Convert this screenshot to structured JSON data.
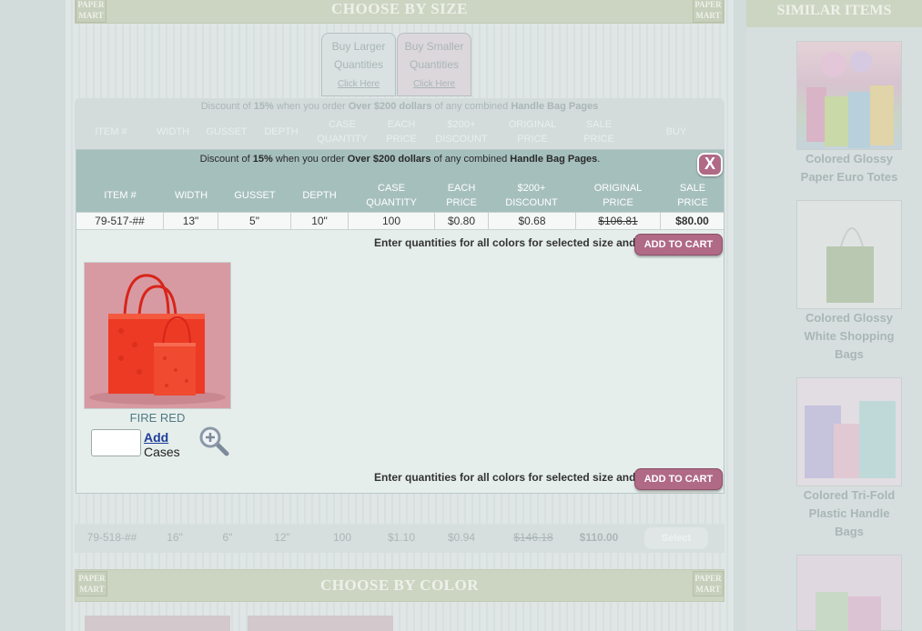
{
  "background": {
    "choose_by_size": "CHOOSE BY SIZE",
    "logo_text": "PAPER MART",
    "tab_larger": {
      "line1": "Buy Larger",
      "line2": "Quantities",
      "link": "Click Here"
    },
    "tab_smaller": {
      "line1": "Buy Smaller",
      "line2": "Quantities",
      "link": "Click Here"
    },
    "discount": {
      "pre": "Discount of ",
      "pct": "15%",
      "mid": " when you order ",
      "amount": "Over $200 dollars",
      "post": " of any combined ",
      "page": "Handle Bag Pages"
    },
    "headers": [
      "ITEM #",
      "WIDTH",
      "GUSSET",
      "DEPTH",
      "CASE QUANTITY",
      "EACH PRICE",
      "$200+ DISCOUNT",
      "ORIGINAL PRICE",
      "SALE PRICE",
      "BUY"
    ],
    "row2": {
      "item": "79-518-##",
      "width": "16\"",
      "gusset": "6\"",
      "depth": "12\"",
      "case_qty": "100",
      "each": "$1.10",
      "discount": "$0.94",
      "original": "$146.18",
      "sale": "$110.00",
      "select_label": "Select"
    },
    "choose_by_color": "CHOOSE BY COLOR"
  },
  "similar": {
    "title": "SIMILAR ITEMS",
    "items": [
      {
        "label1": "Colored Glossy",
        "label2": "Paper Euro Totes",
        "label3": ""
      },
      {
        "label1": "Colored Glossy",
        "label2": "White Shopping",
        "label3": "Bags"
      },
      {
        "label1": "Colored Tri-Fold",
        "label2": "Plastic Handle",
        "label3": "Bags"
      }
    ]
  },
  "modal": {
    "discount": {
      "pre": "Discount of ",
      "pct": "15%",
      "mid": " when you order ",
      "amount": "Over $200 dollars",
      "post": " of any combined ",
      "page": "Handle Bag Pages",
      "end": "."
    },
    "close_label": "X",
    "headers": {
      "item": "ITEM #",
      "width": "WIDTH",
      "gusset": "GUSSET",
      "depth": "DEPTH",
      "case1": "CASE",
      "case2": "QUANTITY",
      "each1": "EACH",
      "each2": "PRICE",
      "disc1": "$200+",
      "disc2": "DISCOUNT",
      "orig1": "ORIGINAL",
      "orig2": "PRICE",
      "sale1": "SALE",
      "sale2": "PRICE"
    },
    "row": {
      "item": "79-517-##",
      "width": "13\"",
      "gusset": "5\"",
      "depth": "10\"",
      "case_qty": "100",
      "each": "$0.80",
      "discount": "$0.68",
      "original": "$106.81",
      "sale": "$80.00"
    },
    "instruction": "Enter quantities for all colors for selected size and",
    "cart_label": "ADD TO CART",
    "product": {
      "color_name": "FIRE RED",
      "add_label": "Add",
      "cases_label": "Cases",
      "qty_value": ""
    }
  },
  "colors": {
    "accent": "#b06a86",
    "header_bg": "#a5bfbd",
    "link": "#1d3c9a"
  }
}
